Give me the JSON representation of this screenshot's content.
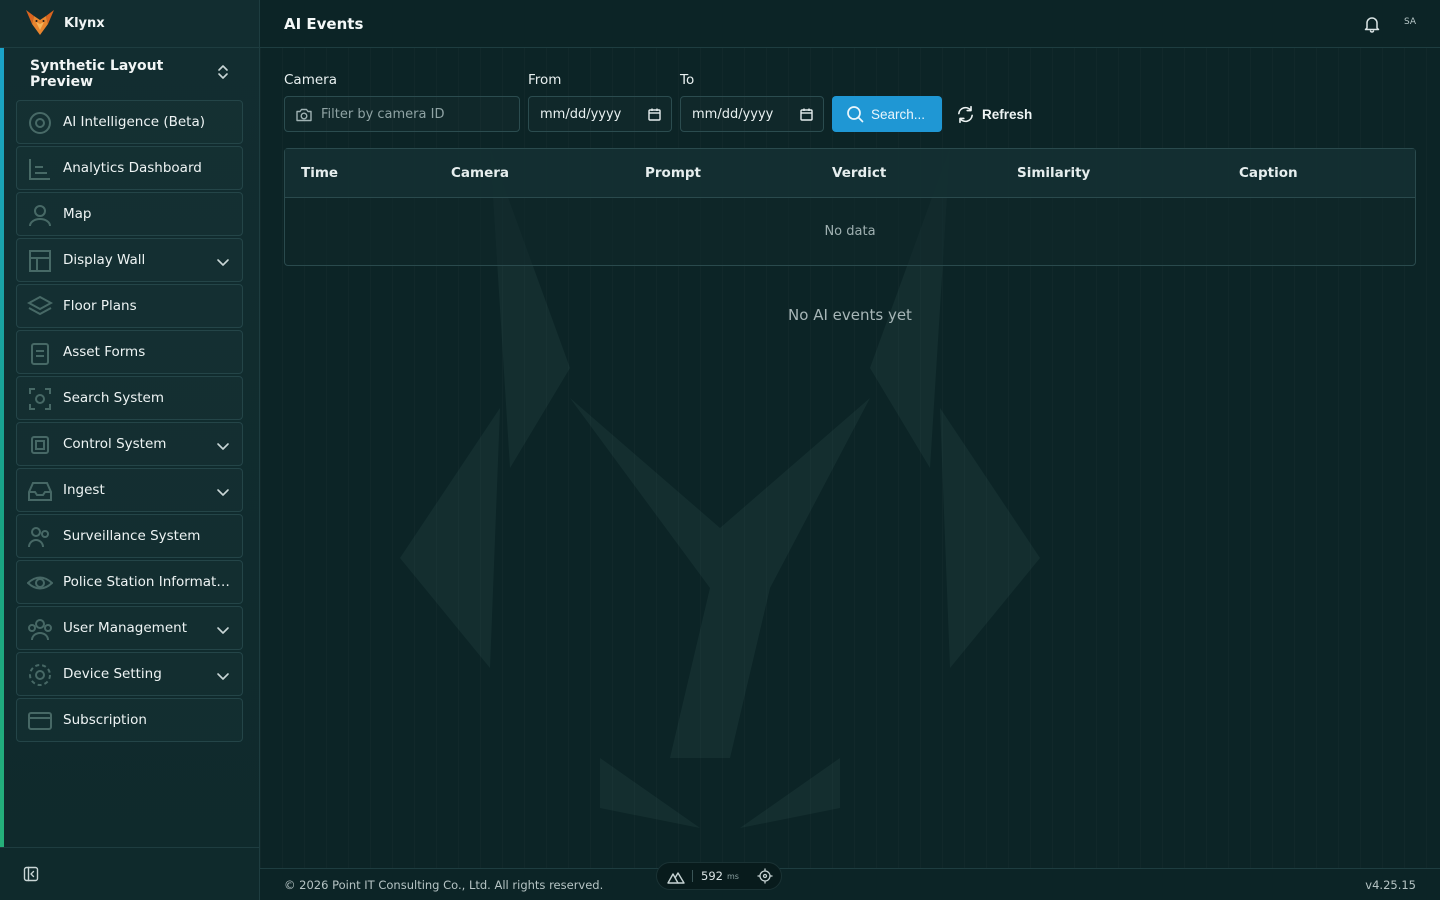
{
  "app": {
    "name": "Klynx",
    "project": "Synthetic Layout Preview"
  },
  "header": {
    "title": "AI Events",
    "avatar": "SA"
  },
  "sidebar": {
    "items": [
      {
        "label": "AI Intelligence (Beta)",
        "icon": "ai-intelligence-icon",
        "expandable": false
      },
      {
        "label": "Analytics Dashboard",
        "icon": "analytics-icon",
        "expandable": false
      },
      {
        "label": "Map",
        "icon": "map-icon",
        "expandable": false
      },
      {
        "label": "Display Wall",
        "icon": "display-wall-icon",
        "expandable": true
      },
      {
        "label": "Floor Plans",
        "icon": "layers-icon",
        "expandable": false
      },
      {
        "label": "Asset Forms",
        "icon": "clipboard-icon",
        "expandable": false
      },
      {
        "label": "Search System",
        "icon": "scan-icon",
        "expandable": false
      },
      {
        "label": "Control System",
        "icon": "cpu-icon",
        "expandable": true
      },
      {
        "label": "Ingest",
        "icon": "inbox-icon",
        "expandable": true
      },
      {
        "label": "Surveillance System",
        "icon": "users-icon",
        "expandable": false
      },
      {
        "label": "Police Station Informati...",
        "icon": "eye-icon",
        "expandable": false
      },
      {
        "label": "User Management",
        "icon": "user-group-icon",
        "expandable": true
      },
      {
        "label": "Device Setting",
        "icon": "gear-icon",
        "expandable": true
      },
      {
        "label": "Subscription",
        "icon": "credit-card-icon",
        "expandable": false
      }
    ]
  },
  "filters": {
    "camera_label": "Camera",
    "camera_placeholder": "Filter by camera ID",
    "from_label": "From",
    "from_value": "mm/dd/yyyy",
    "to_label": "To",
    "to_value": "mm/dd/yyyy",
    "search_label": "Search...",
    "refresh_label": "Refresh"
  },
  "table": {
    "columns": [
      "Time",
      "Camera",
      "Prompt",
      "Verdict",
      "Similarity",
      "Caption"
    ],
    "empty_text": "No data"
  },
  "empty_message": "No AI events yet",
  "footer": {
    "copyright": "© 2026 Point IT Consulting Co., Ltd. All rights reserved.",
    "version": "v4.25.15"
  },
  "perf": {
    "value": "592",
    "unit": "ms"
  },
  "colors": {
    "accent": "#1f97d4",
    "background": "#0c2426",
    "brand": "#e0782a"
  }
}
